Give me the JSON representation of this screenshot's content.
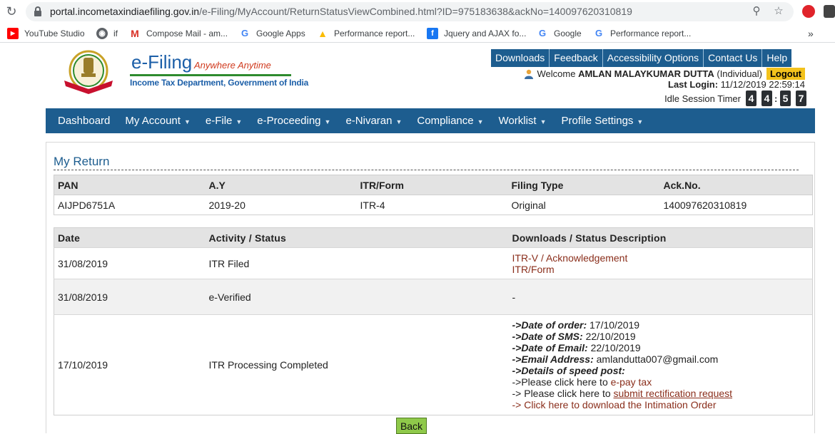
{
  "browser": {
    "url_host": "portal.incometaxindiaefiling.gov.in",
    "url_path": "/e-Filing/MyAccount/ReturnStatusViewCombined.html?ID=975183638&ackNo=140097620310819",
    "bookmarks": [
      {
        "label": "YouTube Studio",
        "icon": "youtube-icon"
      },
      {
        "label": "if",
        "icon": "globe-icon"
      },
      {
        "label": "Compose Mail - am...",
        "icon": "gmail-icon"
      },
      {
        "label": "Google Apps",
        "icon": "google-icon"
      },
      {
        "label": "Performance report...",
        "icon": "google-ads-icon"
      },
      {
        "label": "Jquery and AJAX fo...",
        "icon": "facebook-icon"
      },
      {
        "label": "Google",
        "icon": "google-icon"
      },
      {
        "label": "Performance report...",
        "icon": "google-icon"
      }
    ],
    "more": "»"
  },
  "brand": {
    "title": "e-Filing",
    "tagline": "Anywhere Anytime",
    "department": "Income Tax Department, Government of India",
    "seal_text": "INCOME TAX DEPARTMENT"
  },
  "toplinks": [
    "Downloads",
    "Feedback",
    "Accessibility Options",
    "Contact Us",
    "Help"
  ],
  "user": {
    "welcome_prefix": "Welcome",
    "name": "AMLAN MALAYKUMAR DUTTA",
    "type": "(Individual)",
    "logout": "Logout",
    "last_login_label": "Last Login:",
    "last_login_value": "11/12/2019 22:59:14",
    "timer_label": "Idle Session Timer",
    "timer_digits": [
      "4",
      "4",
      "5",
      "7"
    ]
  },
  "nav": [
    {
      "label": "Dashboard",
      "caret": false
    },
    {
      "label": "My Account",
      "caret": true
    },
    {
      "label": "e-File",
      "caret": true
    },
    {
      "label": "e-Proceeding",
      "caret": true
    },
    {
      "label": "e-Nivaran",
      "caret": true
    },
    {
      "label": "Compliance",
      "caret": true
    },
    {
      "label": "Worklist",
      "caret": true
    },
    {
      "label": "Profile Settings",
      "caret": true
    }
  ],
  "section_title": "My Return",
  "return_table": {
    "headers": [
      "PAN",
      "A.Y",
      "ITR/Form",
      "Filing Type",
      "Ack.No."
    ],
    "row": [
      "AIJPD6751A",
      "2019-20",
      "ITR-4",
      "Original",
      "140097620310819"
    ]
  },
  "status_table": {
    "headers": [
      "Date",
      "Activity / Status",
      "Downloads / Status Description"
    ],
    "rows": [
      {
        "date": "31/08/2019",
        "activity": "ITR Filed",
        "links": [
          "ITR-V / Acknowledgement",
          "ITR/Form"
        ]
      },
      {
        "date": "31/08/2019",
        "activity": "e-Verified",
        "desc": "-"
      },
      {
        "date": "17/10/2019",
        "activity": "ITR Processing Completed",
        "details": {
          "order_label": "->Date of order:",
          "order_value": "17/10/2019",
          "sms_label": "->Date of SMS:",
          "sms_value": "22/10/2019",
          "email_date_label": "->Date of Email:",
          "email_date_value": "22/10/2019",
          "email_label": "->Email Address:",
          "email_value": "amlandutta007@gmail.com",
          "speedpost_label": "->Details of speed post:",
          "epay_prefix": "->Please click here to",
          "epay_link": "e-pay tax",
          "rect_prefix": "-> Please click here to",
          "rect_link": "submit rectification request",
          "intimation_link": "-> Click here to download the Intimation Order"
        }
      }
    ]
  },
  "back_button": "Back"
}
